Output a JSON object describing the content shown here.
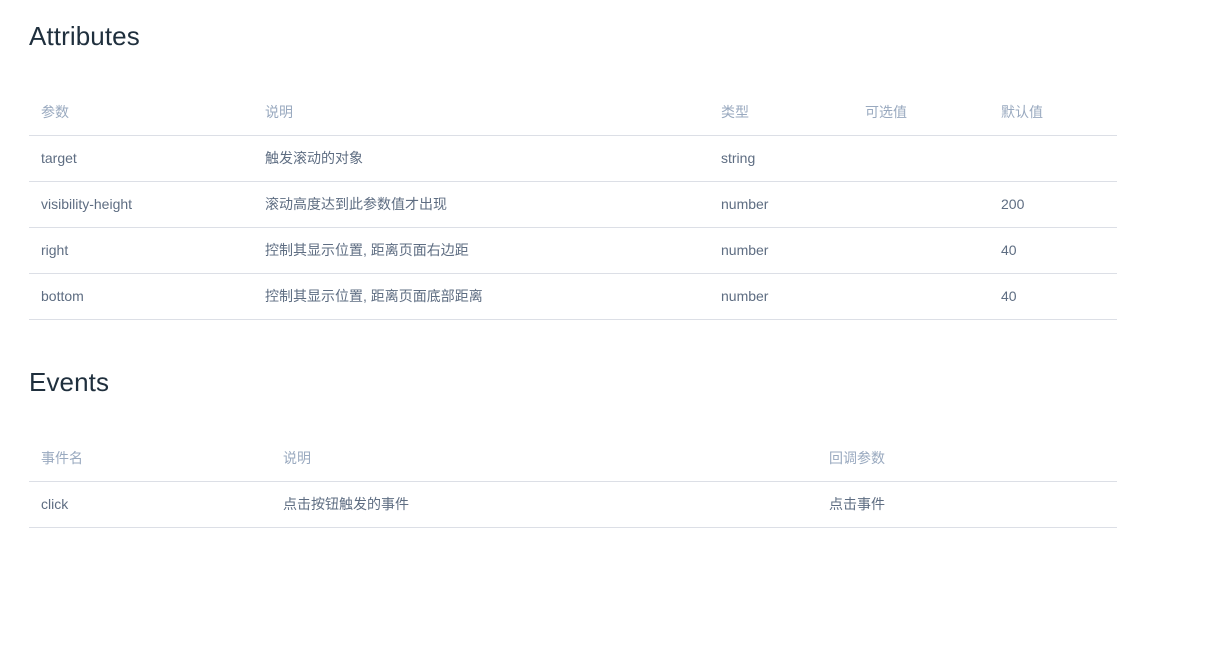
{
  "attributes_section": {
    "title": "Attributes",
    "table": {
      "headers": [
        "参数",
        "说明",
        "类型",
        "可选值",
        "默认值"
      ],
      "rows": [
        {
          "param": "target",
          "description": "触发滚动的对象",
          "type": "string",
          "options": "",
          "default": ""
        },
        {
          "param": "visibility-height",
          "description": "滚动高度达到此参数值才出现",
          "type": "number",
          "options": "",
          "default": "200"
        },
        {
          "param": "right",
          "description": "控制其显示位置, 距离页面右边距",
          "type": "number",
          "options": "",
          "default": "40"
        },
        {
          "param": "bottom",
          "description": "控制其显示位置, 距离页面底部距离",
          "type": "number",
          "options": "",
          "default": "40"
        }
      ]
    }
  },
  "events_section": {
    "title": "Events",
    "table": {
      "headers": [
        "事件名",
        "说明",
        "回调参数"
      ],
      "rows": [
        {
          "event": "click",
          "description": "点击按钮触发的事件",
          "callback": "点击事件"
        }
      ]
    }
  },
  "colors": {
    "heading": "#1f2f3d",
    "header_text": "#99a9bf",
    "body_text": "#5e6d82",
    "border": "#dcdfe6",
    "background": "#ffffff"
  }
}
